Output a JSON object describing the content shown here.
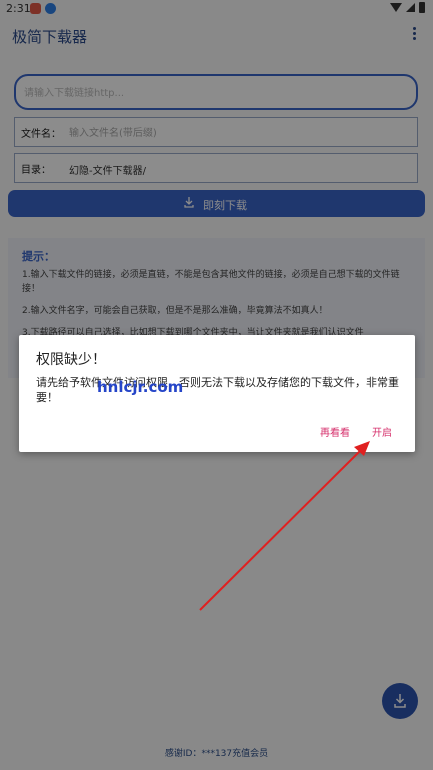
{
  "status_bar": {
    "time": "2:31",
    "icons": [
      "app-notification-icon",
      "download-notification-icon",
      "wifi-icon",
      "signal-icon",
      "battery-icon"
    ]
  },
  "app_bar": {
    "title": "极简下载器",
    "menu_icon": "more-vert-icon"
  },
  "url_input": {
    "placeholder": "请输入下载链接http...",
    "value": ""
  },
  "filename_field": {
    "label": "文件名：",
    "placeholder": "输入文件名(带后缀)",
    "value": ""
  },
  "directory_field": {
    "label": "目录：",
    "value": "幻隐-文件下载器/"
  },
  "download_button": {
    "label": "即刻下载",
    "icon": "download-icon"
  },
  "tips": {
    "heading": "提示：",
    "items": [
      "1.输入下载文件的链接，必须是直链，不能是包含其他文件的链接，必须是自己想下载的文件链接！",
      "2.输入文件名字，可能会自己获取，但是不是那么准确，毕竟算法不如真人！",
      "3.下载路径可以自己选择，比如想下载到哪个文件夹中，当让文件夹就是我们认识文件"
    ]
  },
  "dialog": {
    "title": "权限缺少！",
    "message": "请先给予软件文件访问权限，否则无法下载以及存储您的下载文件，非常重要！",
    "buttons": {
      "later": "再看看",
      "open": "开启"
    }
  },
  "watermark": "hnlcjr.com",
  "fab": {
    "icon": "download-icon"
  },
  "footer": {
    "text": "感谢ID：***137充值会员"
  },
  "colors": {
    "primary": "#3a64c8",
    "accent": "#d6306c",
    "arrow": "#e02020",
    "overlay": "rgba(0,0,0,0.45)"
  }
}
